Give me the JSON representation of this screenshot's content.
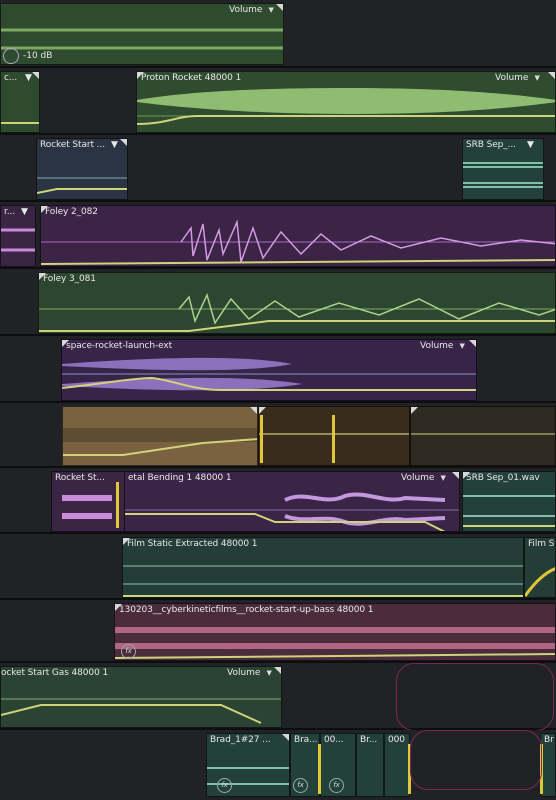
{
  "clip_labels": {
    "t1_volume": "Volume",
    "t1_gain": "-10 dB",
    "t2_left": "c...",
    "t2_main": "Proton Rocket 48000 1",
    "t2_volume": "Volume",
    "t3_a": "Rocket Start ...",
    "t3_b": "SRB Sep_...",
    "t4_left": "r...",
    "t4_main": "Foley 2_082",
    "t5_main": "Foley 3_081",
    "t6_main": "space-rocket-launch-ext",
    "t6_volume": "Volume",
    "t8_a": "Rocket St...",
    "t8_b": "etal Bending 1 48000 1",
    "t8_volume": "Volume",
    "t8_c": "SRB Sep_01.wav",
    "t9_main": "Film Static Extracted 48000 1",
    "t9_right": "Film Sta",
    "t10_main": "130203__cyberkineticfilms__rocket-start-up-bass 48000 1",
    "t11_main": "ocket Start Gas 48000 1",
    "t11_volume": "Volume",
    "t12_a": "Brad_1#27 ...",
    "t12_b": "Bra...",
    "t12_c": "00...",
    "t12_d": "Br...",
    "t12_e": "000",
    "t12_f": "Br"
  },
  "colors": {
    "green": "#2f4a30",
    "teal": "#24403a",
    "purple": "#3a2544",
    "tan": "#6e5838",
    "rose": "#4a2c3c",
    "navy": "#2a3442",
    "envelope": "#cfd37a"
  },
  "icons": {
    "clip_menu": "caret-down-icon",
    "effects": "fx-icon",
    "gain": "gain-knob-icon"
  }
}
